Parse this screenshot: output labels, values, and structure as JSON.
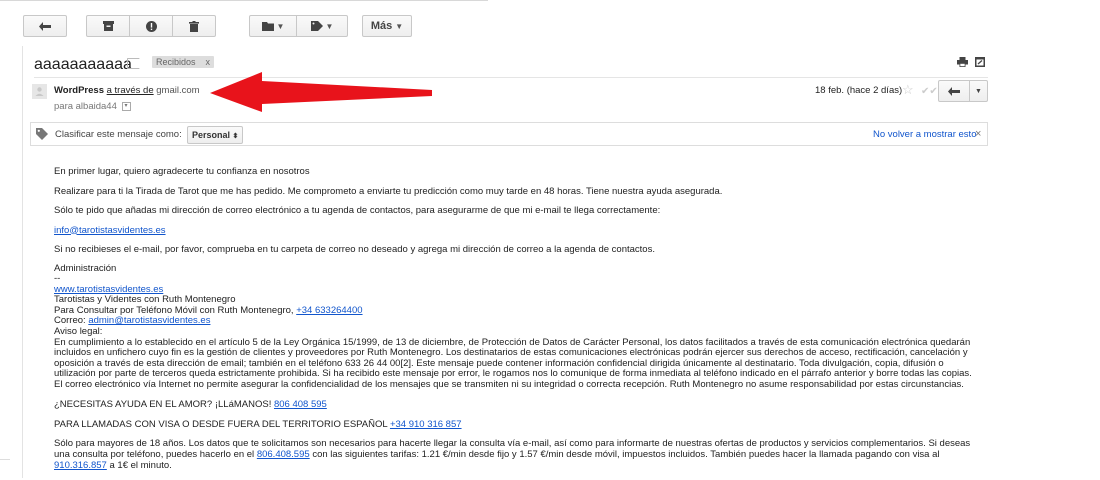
{
  "toolbar": {
    "more_label": "Más"
  },
  "subject": "aaaaaaaaaaa",
  "label_chip": {
    "text": "Recibidos",
    "close": "x"
  },
  "sender": {
    "name": "WordPress",
    "via": "a través de",
    "domain": "gmail.com"
  },
  "to": {
    "text": "para albaida44"
  },
  "date": "18 feb. (hace 2 días)",
  "classify": {
    "prompt": "Clasificar este mensaje como:",
    "selected": "Personal",
    "dismiss": "No volver a mostrar esto",
    "close": "×"
  },
  "body": {
    "p1": "En primer lugar, quiero agradecerte tu confianza en nosotros",
    "p2": "Realizare para ti la Tirada de Tarot que me has pedido. Me comprometo a enviarte tu predicción como muy tarde en 48 horas. Tiene nuestra ayuda asegurada.",
    "p3": "Sólo te pido que añadas mi dirección de correo electrónico a tu agenda de contactos, para asegurarme de que mi e-mail te llega correctamente:",
    "email_link": "info@tarotistasvidentes.es",
    "p4": "Si no recibieses el e-mail, por favor, comprueba en tu carpeta de correo no deseado y agrega mi dirección de correo a la agenda de contactos.",
    "sig": {
      "admin": "Administración",
      "dashes": "--",
      "site_link": "www.tarotistasvidentes.es",
      "line1": "Tarotistas y Videntes con Ruth Montenegro",
      "line2": "Para Consultar por Teléfono Móvil con Ruth Montenegro,",
      "phone_link": "+34 633264400",
      "correo_label": "Correo:",
      "correo_link": "admin@tarotistasvidentes.es",
      "legal_label": "Aviso legal:",
      "legal": "En cumplimiento a lo establecido en el artículo 5 de la Ley Orgánica 15/1999, de 13 de diciembre, de Protección de Datos de Carácter Personal, los datos facilitados a través de esta comunicación electrónica quedarán incluidos en unfichero cuyo fin es la gestión de clientes y proveedores por Ruth Montenegro. Los destinatarios de estas comunicaciones electrónicas podrán ejercer sus derechos de acceso, rectificación, cancelación y oposición a través de esta dirección de email; también en el teléfono 633 26 44 00[2]. Este mensaje puede contener información confidencial dirigida únicamente al destinatario. Toda divulgación, copia, difusión o utilización por parte de terceros queda estrictamente prohibida. Si ha recibido este mensaje por error, le rogamos nos lo comunique de forma inmediata al teléfono indicado en el párrafo anterior y borre todas las copias. El correo electrónico vía Internet no permite asegurar la confidencialidad de los mensajes que se transmiten ni su integridad o correcta recepción. Ruth Montenegro no asume responsabilidad por estas circunstancias."
    },
    "amor_text": "¿NECESITAS AYUDA EN EL AMOR? ¡LLáMANOS!",
    "amor_link": "806 408 595",
    "visa_text": "PARA LLAMADAS CON VISA O DESDE FUERA DEL TERRITORIO ESPAÑOL",
    "visa_link": "+34 910 316 857",
    "final_a": "Sólo para mayores de 18 años. Los datos que te solicitamos son necesarios para hacerte llegar la consulta vía e-mail, así como para informarte de nuestras ofertas de productos y servicios complementarios. Si deseas una consulta por teléfono, puedes hacerlo en el",
    "final_link1": "806.408.595",
    "final_b": "con las siguientes tarifas: 1.21 €/min desde fijo y 1.57 €/min desde móvil, impuestos incluidos. También puedes hacer la llamada pagando con visa al",
    "final_link2": "910.316.857",
    "final_c": "a 1€ el minuto."
  },
  "colors": {
    "link": "#1155cc",
    "arrow": "#e8131b"
  }
}
